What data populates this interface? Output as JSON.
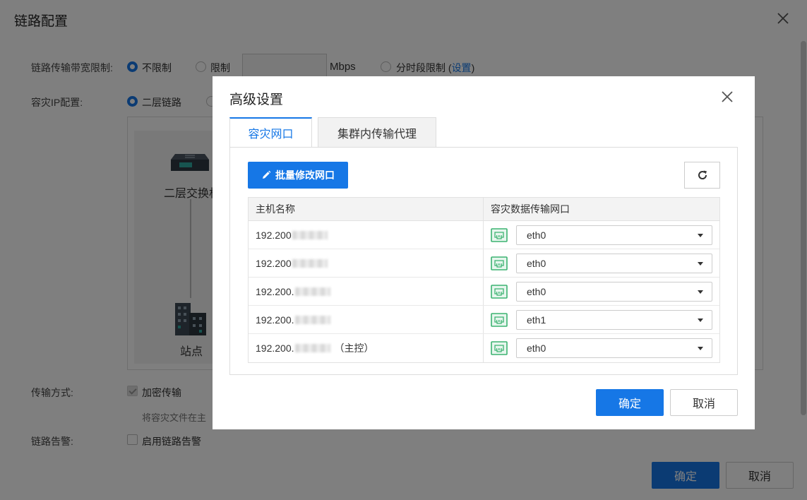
{
  "window": {
    "title": "链路配置"
  },
  "form": {
    "bandwidth_label": "链路传输带宽限制:",
    "bandwidth_options": [
      "不限制",
      "限制",
      "分时段限制 ("
    ],
    "bandwidth_unit": "Mbps",
    "bandwidth_setting_link": "设置",
    "bandwidth_paren_close": ")",
    "dr_ip_label": "容灾IP配置:",
    "dr_ip_option": "二层链路",
    "topology": {
      "switch_label": "二层交换机",
      "site_label": "站点"
    },
    "transfer_label": "传输方式:",
    "encrypt_option": "加密传输",
    "encrypt_hint": "将容灾文件在主",
    "alarm_label": "链路告警:",
    "alarm_option": "启用链路告警"
  },
  "footer": {
    "ok_label": "确定",
    "cancel_label": "取消"
  },
  "dialog": {
    "title": "高级设置",
    "tabs": [
      {
        "label": "容灾网口",
        "active": true
      },
      {
        "label": "集群内传输代理",
        "active": false
      }
    ],
    "batch_button": "批量修改网口",
    "table": {
      "columns": [
        "主机名称",
        "容灾数据传输网口"
      ],
      "rows": [
        {
          "host": "192.200",
          "suffix": "",
          "port": "eth0"
        },
        {
          "host": "192.200",
          "suffix": "",
          "port": "eth0"
        },
        {
          "host": "192.200.",
          "suffix": "",
          "port": "eth0"
        },
        {
          "host": "192.200.",
          "suffix": "",
          "port": "eth1"
        },
        {
          "host": "192.200.",
          "suffix": "（主控）",
          "port": "eth0"
        }
      ]
    },
    "ok_label": "确定",
    "cancel_label": "取消"
  },
  "colors": {
    "primary": "#1677e6",
    "port_icon": "#3cb371"
  }
}
